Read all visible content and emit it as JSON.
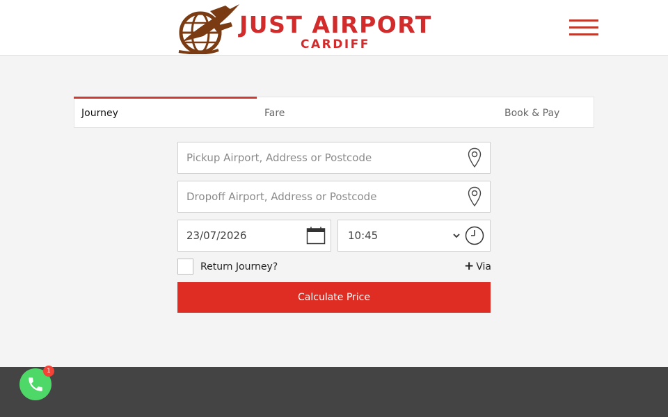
{
  "brand": {
    "name_main": "JUST AIRPORT",
    "name_sub": "CARDIFF",
    "color": "#d22b2b"
  },
  "header": {
    "menu_icon": "hamburger-menu-icon"
  },
  "tabs": [
    {
      "label": "Journey",
      "active": true
    },
    {
      "label": "Fare",
      "active": false
    },
    {
      "label": "Book & Pay",
      "active": false
    }
  ],
  "form": {
    "pickup": {
      "placeholder": "Pickup Airport, Address or Postcode",
      "value": "",
      "icon": "location-pin-icon"
    },
    "dropoff": {
      "placeholder": "Dropoff Airport, Address or Postcode",
      "value": "",
      "icon": "location-pin-icon"
    },
    "date": {
      "value": "23/07/2026",
      "icon": "calendar-icon"
    },
    "time": {
      "value": "10:45",
      "icon": "clock-icon"
    },
    "return_label": "Return Journey?",
    "return_checked": false,
    "via_label": "Via",
    "via_icon": "plus-icon",
    "submit_label": "Calculate Price",
    "accent_color": "#e02d24"
  },
  "phone_fab": {
    "icon": "phone-icon",
    "badge_count": "1",
    "color": "#4dd868"
  },
  "footer": {
    "color": "#444444"
  }
}
